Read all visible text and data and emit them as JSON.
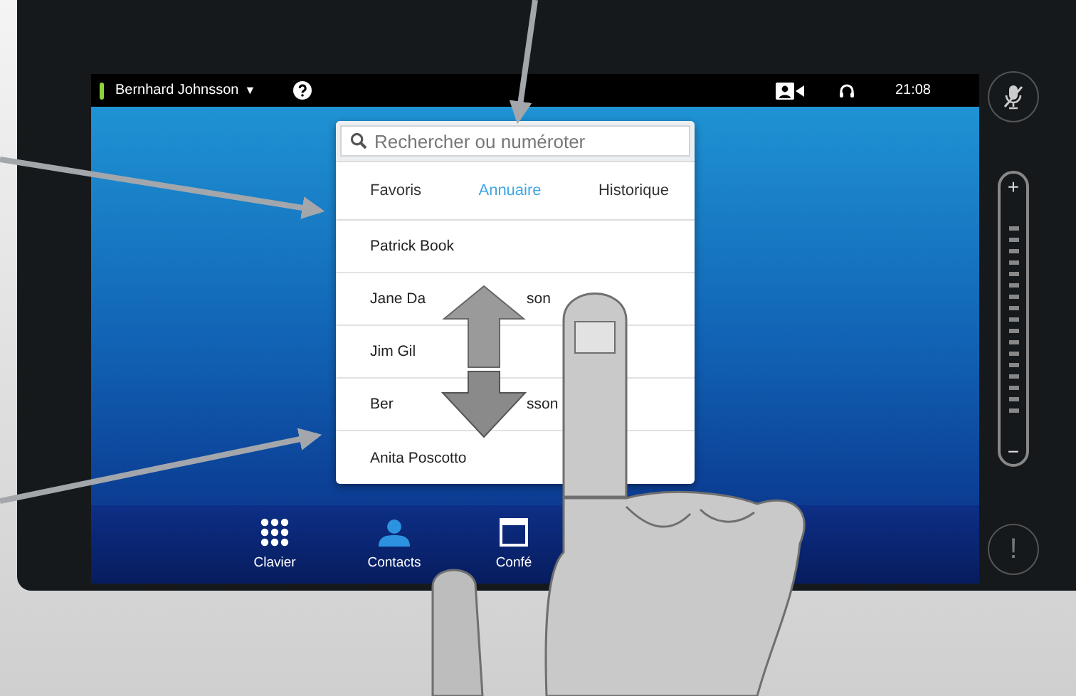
{
  "top_bar": {
    "user": "Bernhard Johnsson",
    "caret": "▼",
    "clock": "21:08"
  },
  "search": {
    "placeholder": "Rechercher ou numéroter"
  },
  "tabs": [
    {
      "label": "Favoris",
      "selected": false
    },
    {
      "label": "Annuaire",
      "selected": true
    },
    {
      "label": "Historique",
      "selected": false
    }
  ],
  "contacts": [
    {
      "parts": [
        "Patrick Book"
      ]
    },
    {
      "parts": [
        "Jane Da",
        "son"
      ]
    },
    {
      "parts": [
        "Jim Gil"
      ]
    },
    {
      "parts": [
        "Ber",
        "sson"
      ]
    },
    {
      "parts": [
        "Anita Poscotto"
      ]
    }
  ],
  "dock": [
    {
      "kind": "keypad",
      "label": "Clavier",
      "selected": false
    },
    {
      "kind": "contacts",
      "label": "Contacts",
      "selected": true
    },
    {
      "kind": "conference",
      "label": "Confé",
      "selected": false
    }
  ],
  "volume": {
    "plus": "+",
    "minus": "−"
  },
  "alert": "!"
}
